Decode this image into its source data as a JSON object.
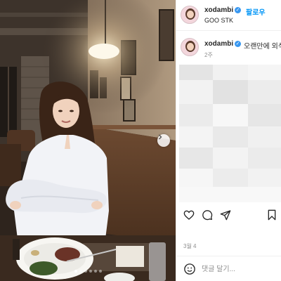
{
  "post": {
    "username": "xodambi",
    "follow_label": "팔로우",
    "location": "GOO STK",
    "caption_username": "xodambi",
    "caption_text": "오랜만에 외식",
    "time_ago": "2주",
    "date": "3월 4",
    "comment_placeholder": "댓글 달기..."
  },
  "carousel": {
    "slide_count": 6,
    "active_index": 0
  },
  "icons": {
    "verified": "verified-badge-icon",
    "like": "heart-icon",
    "comment": "comment-icon",
    "share": "paper-plane-icon",
    "save": "bookmark-icon",
    "emoji": "smiley-icon",
    "next": "chevron-right-icon"
  },
  "colors": {
    "accent": "#0095f6",
    "verified": "#3897f0",
    "muted": "#8e8e8e",
    "text": "#262626"
  }
}
